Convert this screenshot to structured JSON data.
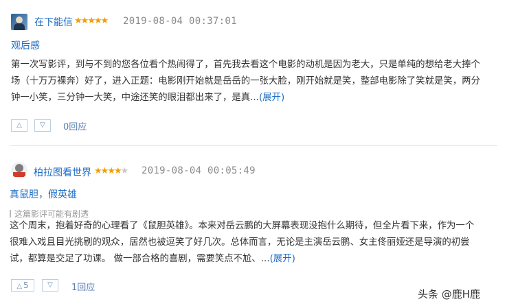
{
  "reviews": [
    {
      "username": "在下能信",
      "rating": 5,
      "rating_max": 5,
      "timestamp": "2019-08-04 00:37:01",
      "title": "观后感",
      "spoiler_notice": "",
      "body_lines": [
        "第一次写影评，到与不到的您各位看个热闹得了，首先我去看这个电影的动机是因为老大，只是单纯的想给老大捧个",
        "场（十万万裸奔）好了，进入正题：电影刚开始就是岳岳的一张大脸，刚开始就是笑，整部电影除了笑就是笑，两分",
        "钟一小笑，三分钟一大笑，中途还笑的眼泪都出来了，是真..."
      ],
      "expand_label": "(展开)",
      "upvotes": "",
      "reply_label": "0回应"
    },
    {
      "username": "柏拉图看世界",
      "rating": 4,
      "rating_max": 5,
      "timestamp": "2019-08-04 00:05:49",
      "title": "真鼠胆，假英雄",
      "spoiler_notice": "这篇影评可能有剧透",
      "body_lines": [
        "这个周末，抱着好奇的心理看了《鼠胆英雄》。本来对岳云鹏的大屏幕表现没抱什么期待，但全片看下来，作为一个",
        "很难入戏且目光挑剔的观众，居然也被逗笑了好几次。总体而言，无论是主演岳云鹏、女主佟丽娅还是导演的初尝",
        "试，都算是交足了功课。 做一部合格的喜剧，需要笑点不尬、..."
      ],
      "expand_label": "(展开)",
      "upvotes": "5",
      "reply_label": "1回应"
    }
  ],
  "watermark": "头条 @鹿H鹿",
  "icons": {
    "star": "star-icon",
    "vote_up": "triangle-up-icon",
    "vote_down": "triangle-down-icon"
  },
  "colors": {
    "link": "#1a6bc4",
    "star_on": "#f29d0a",
    "star_off": "#c9c9c9",
    "timestamp": "#8a8a8a",
    "body_text": "#333333",
    "vote_border": "#b9cde3"
  }
}
